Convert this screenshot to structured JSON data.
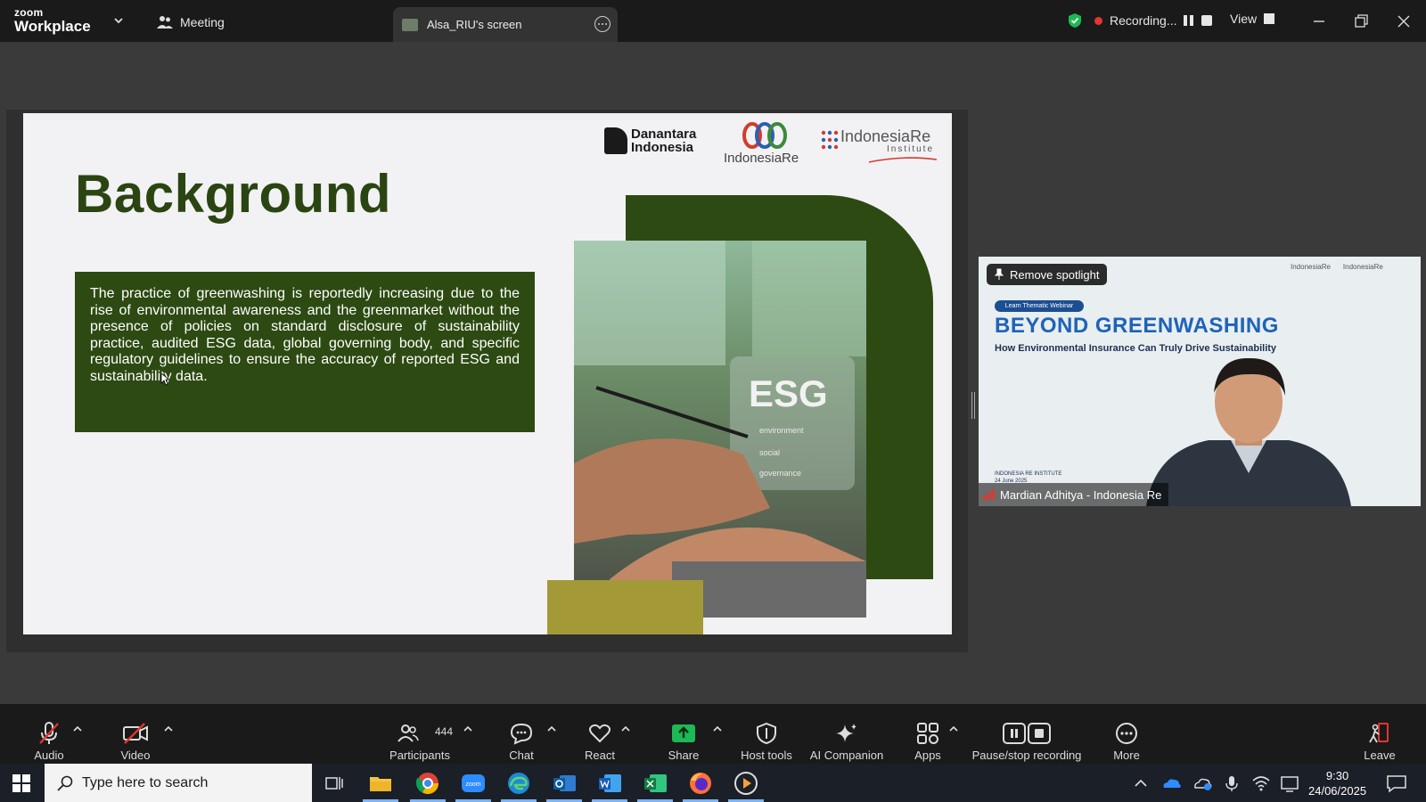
{
  "app": {
    "logo_line1": "zoom",
    "logo_line2": "Workplace",
    "meeting_tab": "Meeting",
    "screen_tab": "Alsa_RIU's screen",
    "recording_label": "Recording...",
    "view_label": "View"
  },
  "slide": {
    "title": "Background",
    "body": "The practice of greenwashing is reportedly increasing due to the rise of environmental awareness and the greenmarket without the presence of policies on standard disclosure of sustainability practice, audited ESG data, global governing body, and specific regulatory guidelines to ensure the accuracy of reported ESG and sustainability data.",
    "logo_danantara_1": "Danantara",
    "logo_danantara_2": "Indonesia",
    "logo_indonesiare": "IndonesiaRe",
    "logo_iri_1": "IndonesiaRe",
    "logo_iri_2": "Institute",
    "photo_esg": "ESG",
    "photo_env": "environment",
    "photo_soc": "social",
    "photo_gov": "governance"
  },
  "participant_video": {
    "spotlight_button": "Remove spotlight",
    "badge": "Learn Thematic Webinar",
    "title": "BEYOND GREENWASHING",
    "subtitle": "How Environmental Insurance Can Truly Drive Sustainability",
    "foot_1": "INDONESIA RE INSTITUTE",
    "foot_2": "24 June 2025",
    "name": "Mardian Adhitya - Indonesia Re"
  },
  "toolbar": {
    "audio": "Audio",
    "video": "Video",
    "participants": "Participants",
    "participants_count": "444",
    "chat": "Chat",
    "react": "React",
    "share": "Share",
    "host_tools": "Host tools",
    "ai_companion": "AI Companion",
    "apps": "Apps",
    "pause_stop": "Pause/stop recording",
    "more": "More",
    "leave": "Leave"
  },
  "taskbar": {
    "search_placeholder": "Type here to search",
    "time": "9:30",
    "date": "24/06/2025"
  },
  "colors": {
    "slide_green": "#2d4a12",
    "slide_olive": "#a39a37",
    "share_green": "#1db954",
    "record_red": "#e2362f",
    "leave_red": "#e2362f"
  }
}
